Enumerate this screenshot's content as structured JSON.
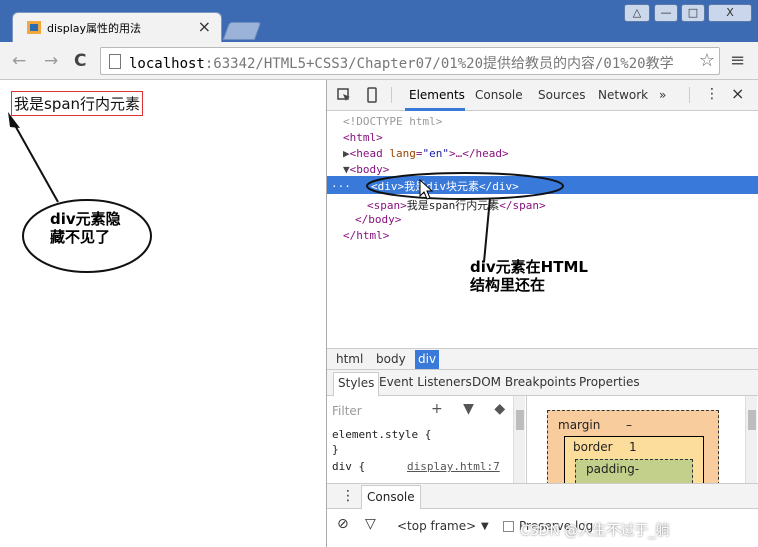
{
  "browser": {
    "tab_title": "display属性的用法",
    "tab_close": "×",
    "url_host": "localhost",
    "url_rest": ":63342/HTML5+CSS3/Chapter07/01%20提供给教员的内容/01%20教学",
    "window_buttons": [
      "△",
      "—",
      "□",
      "X"
    ],
    "nav_back": "←",
    "nav_forward": "→",
    "reload": "C",
    "star": "☆",
    "menu": "≡"
  },
  "page": {
    "span_text": "我是span行内元素"
  },
  "devtools": {
    "tabs": [
      "Elements",
      "Console",
      "Sources",
      "Network",
      "»"
    ],
    "active_tab": "Elements",
    "more_menu": "⋮",
    "close": "×",
    "dom": {
      "doctype": "<!DOCTYPE html>",
      "html_open": "<html>",
      "head_line": "<head lang=\"en\">…</head>",
      "head_tag": "<head",
      "head_attr": "lang",
      "head_val": "\"en\"",
      "head_rest": ">…</head>",
      "body_open": "<body>",
      "div_line": "<div>我是div块元素</div>",
      "span_line": "<span>我是span行内元素</span>",
      "span_open": "<span>",
      "span_text": "我是span行内元素",
      "span_close": "</span>",
      "body_close": "</body>",
      "html_close": "</html>",
      "dots": "..."
    },
    "breadcrumbs": [
      "html",
      "body",
      "div"
    ],
    "sub_tabs": [
      "Styles",
      "Event Listeners",
      "DOM Breakpoints",
      "Properties"
    ],
    "styles": {
      "filter_placeholder": "Filter",
      "icons": "+ ▼ ◆",
      "rule1": "element.style {",
      "rule1_close": "}",
      "rule2": "div {",
      "rule2_link": "display.html:7"
    },
    "box_model": {
      "margin_label": "margin",
      "margin_value": "–",
      "border_label": "border",
      "border_value": "1",
      "padding_label": "padding-"
    },
    "console": {
      "tab": "Console",
      "handle": "⋮",
      "clear_icon": "⊘",
      "filter_icon": "▽",
      "frame": "<top frame>",
      "frame_arrow": "▼",
      "preserve": "Preserve log"
    }
  },
  "annotations": {
    "note_left": [
      "div元素隐",
      "藏不见了"
    ],
    "note_right": [
      "div元素在HTML",
      "结构里还在"
    ]
  },
  "watermark": "CSDN @人生不过于_躺"
}
